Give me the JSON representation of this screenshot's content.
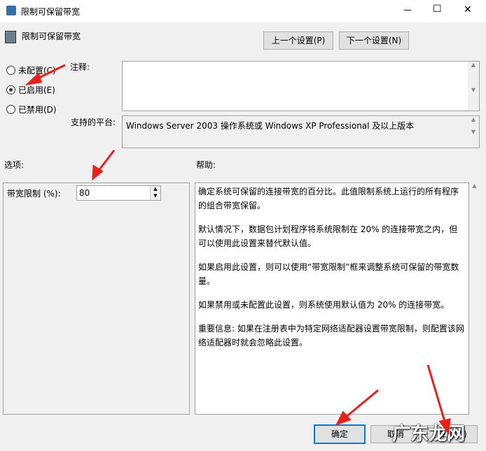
{
  "window": {
    "title": "限制可保留带宽",
    "minimize": "—",
    "maximize": "☐",
    "close": "✕"
  },
  "header": {
    "title": "限制可保留带宽",
    "prev_label": "上一个设置(P)",
    "next_label": "下一个设置(N)"
  },
  "radios": [
    {
      "label": "未配置(C)",
      "checked": false
    },
    {
      "label": "已启用(E)",
      "checked": true
    },
    {
      "label": "已禁用(D)",
      "checked": false
    }
  ],
  "comment": {
    "label": "注释:",
    "value": ""
  },
  "platform": {
    "label": "支持的平台:",
    "value": "Windows Server 2003 操作系统或 Windows XP Professional 及以上版本"
  },
  "options": {
    "label": "选项:",
    "bandwidth_label": "带宽限制 (%):",
    "bandwidth_value": "80"
  },
  "help": {
    "label": "帮助:",
    "paragraphs": [
      "确定系统可保留的连接带宽的百分比。此值限制系统上运行的所有程序的组合带宽保留。",
      "默认情况下，数据包计划程序将系统限制在 20% 的连接带宽之内，但可以使用此设置来替代默认值。",
      "如果启用此设置，则可以使用“带宽限制”框来调整系统可保留的带宽数量。",
      "如果禁用或未配置此设置，则系统使用默认值为 20% 的连接带宽。",
      "重要信息: 如果在注册表中为特定网络适配器设置带宽限制，则配置该网络适配器时就会忽略此设置。"
    ]
  },
  "buttons": {
    "ok": "确定",
    "cancel": "取消",
    "apply": "应用(A)"
  },
  "watermark": "广东龙网"
}
